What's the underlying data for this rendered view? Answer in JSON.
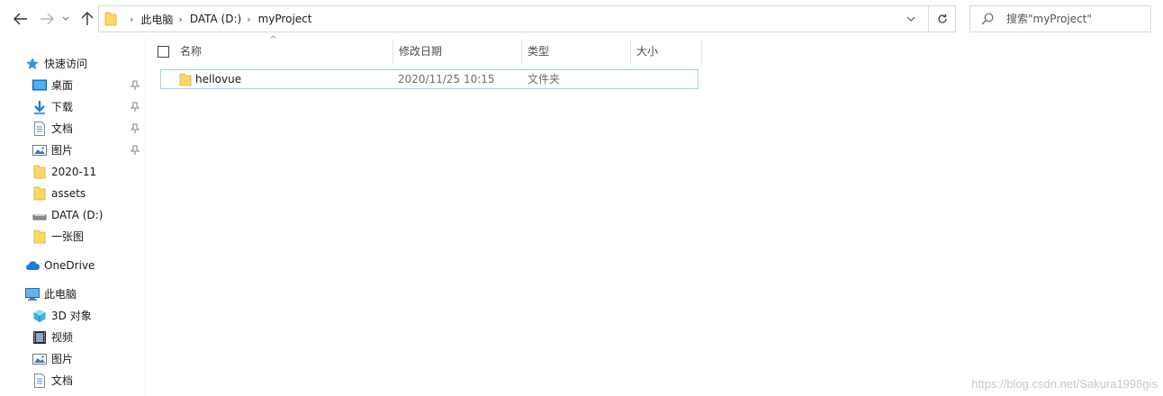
{
  "address_bar": {
    "crumbs": [
      "此电脑",
      "DATA (D:)",
      "myProject"
    ]
  },
  "search": {
    "placeholder": "搜索\"myProject\""
  },
  "nav": {
    "quick_access": {
      "label": "快速访问",
      "icon": "star-icon"
    },
    "items": [
      {
        "label": "桌面",
        "icon": "desktop-icon",
        "pinned": true
      },
      {
        "label": "下载",
        "icon": "download-icon",
        "pinned": true
      },
      {
        "label": "文档",
        "icon": "document-icon",
        "pinned": true
      },
      {
        "label": "图片",
        "icon": "pictures-icon",
        "pinned": true
      },
      {
        "label": "2020-11",
        "icon": "folder-icon",
        "pinned": false
      },
      {
        "label": "assets",
        "icon": "folder-icon",
        "pinned": false
      },
      {
        "label": "DATA (D:)",
        "icon": "drive-icon",
        "pinned": false
      },
      {
        "label": "一张图",
        "icon": "folder-icon",
        "pinned": false
      }
    ],
    "onedrive": {
      "label": "OneDrive",
      "icon": "cloud-icon"
    },
    "this_pc": {
      "label": "此电脑",
      "icon": "computer-icon"
    },
    "pc_items": [
      {
        "label": "3D 对象",
        "icon": "cube-icon"
      },
      {
        "label": "视频",
        "icon": "video-icon"
      },
      {
        "label": "图片",
        "icon": "pictures-icon"
      },
      {
        "label": "文档",
        "icon": "document-icon"
      }
    ]
  },
  "columns": {
    "name": "名称",
    "date": "修改日期",
    "type": "类型",
    "size": "大小"
  },
  "files": [
    {
      "name": "hellovue",
      "date": "2020/11/25 10:15",
      "type": "文件夹",
      "size": ""
    }
  ],
  "watermark": "https://blog.csdn.net/Sakura1998gis",
  "colors": {
    "folder": "#ffd863",
    "selection_border": "#99d1ff",
    "accent": "#1a73c8"
  }
}
